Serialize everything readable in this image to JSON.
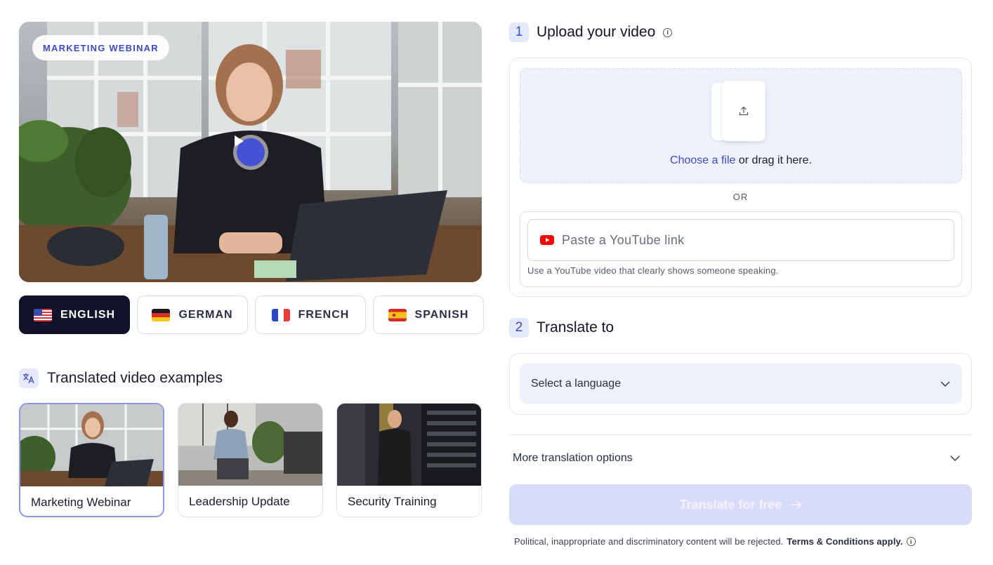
{
  "hero": {
    "tag": "MARKETING WEBINAR",
    "play_icon": "play-icon"
  },
  "languages": [
    {
      "label": "ENGLISH",
      "flag": "us-flag",
      "active": true
    },
    {
      "label": "GERMAN",
      "flag": "de-flag",
      "active": false
    },
    {
      "label": "FRENCH",
      "flag": "fr-flag",
      "active": false
    },
    {
      "label": "SPANISH",
      "flag": "es-flag",
      "active": false
    }
  ],
  "examples": {
    "title": "Translated video examples",
    "icon": "translate-icon",
    "items": [
      {
        "label": "Marketing Webinar",
        "active": true
      },
      {
        "label": "Leadership Update",
        "active": false
      },
      {
        "label": "Security Training",
        "active": false
      }
    ]
  },
  "step1": {
    "number": "1",
    "title": "Upload your video",
    "dropzone": {
      "link": "Choose a file",
      "rest": " or drag it here."
    },
    "or": "OR",
    "youtube": {
      "placeholder": "Paste a YouTube link",
      "hint": "Use a YouTube video that clearly shows someone speaking."
    }
  },
  "step2": {
    "number": "2",
    "title": "Translate to",
    "select_placeholder": "Select a language"
  },
  "more_options": "More translation options",
  "submit_label": "Translate for free",
  "disclaimer": {
    "text": "Political, inappropriate and discriminatory content will be rejected.",
    "terms": "Terms & Conditions apply."
  },
  "colors": {
    "accent": "#3e4bc2",
    "dark_button": "#12132b",
    "panel_bg": "#eef0fc",
    "submit_disabled": "#d9dcf9"
  }
}
